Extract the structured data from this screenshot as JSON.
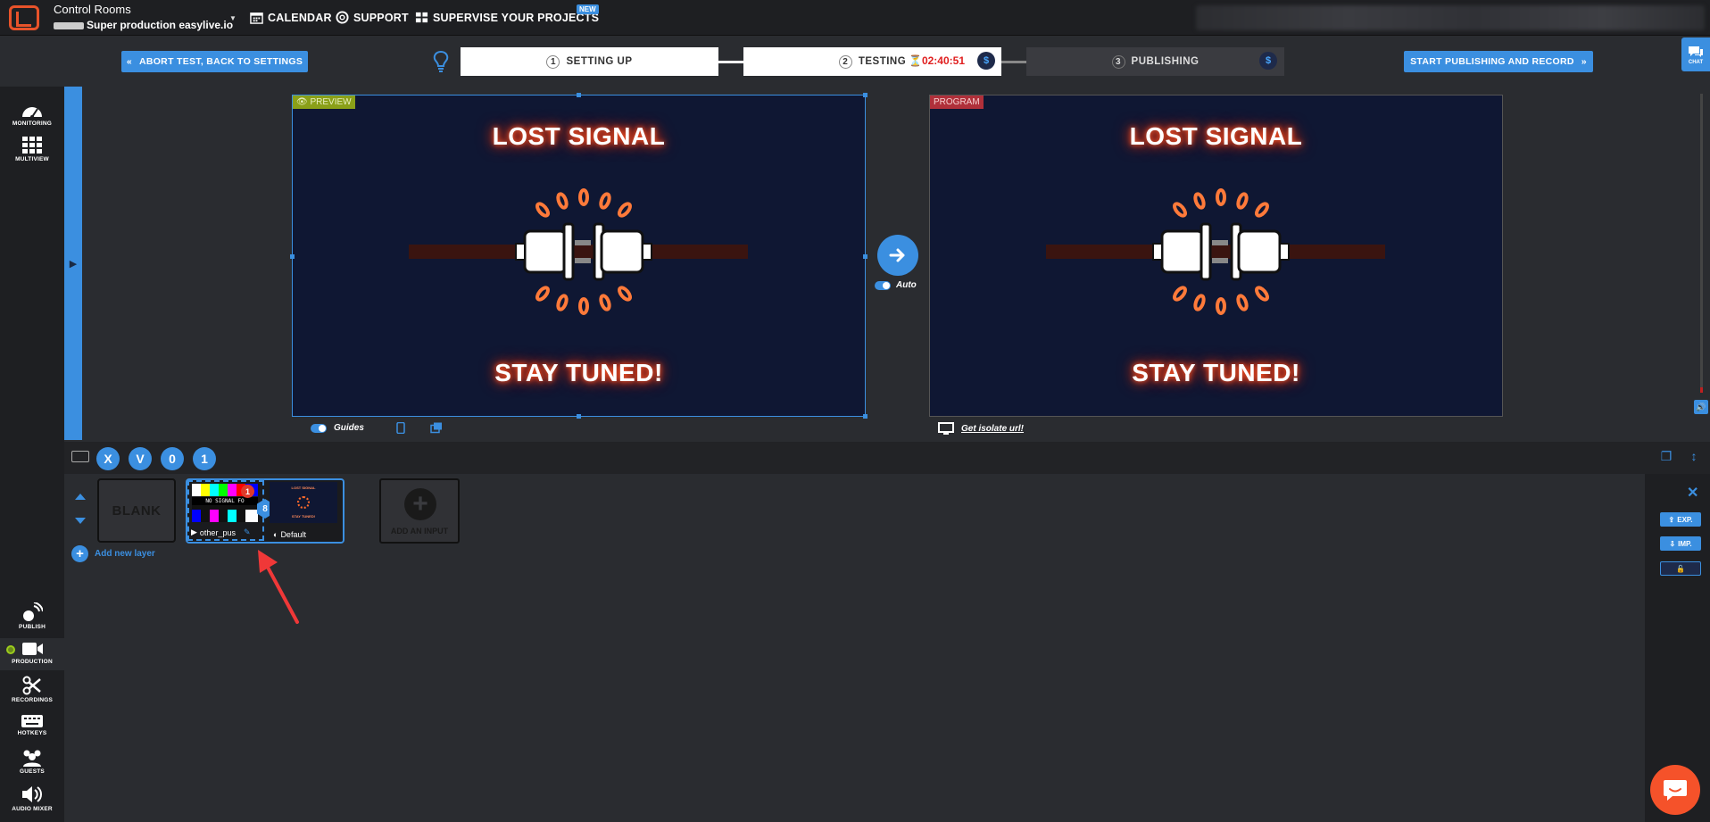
{
  "topbar": {
    "brand_title": "Control Rooms",
    "brand_sub": "Super production easylive.io",
    "nav": {
      "calendar": "CALENDAR",
      "support": "SUPPORT",
      "supervise": "SUPERVISE YOUR PROJECTS",
      "new_badge": "NEW"
    }
  },
  "steps": {
    "abort_label": "ABORT TEST, BACK TO SETTINGS",
    "step1_num": "1",
    "step1_label": "SETTING UP",
    "step2_num": "2",
    "step2_label": "TESTING",
    "timer": "02:40:51",
    "step3_num": "3",
    "step3_label": "PUBLISHING",
    "dollar": "$",
    "start_label": "START PUBLISHING AND RECORD",
    "chat_label": "CHAT"
  },
  "sidebar": {
    "monitoring": "MONITORING",
    "multiview": "MULTIVIEW",
    "publish": "PUBLISH",
    "production": "PRODUCTION",
    "recordings": "RECORDINGS",
    "hotkeys": "HOTKEYS",
    "guests": "GUESTS",
    "audio_mixer": "AUDIO MIXER"
  },
  "preview": {
    "tag": "PREVIEW",
    "headline": "LOST SIGNAL",
    "footer": "STAY TUNED!"
  },
  "program": {
    "tag": "PROGRAM",
    "headline": "LOST SIGNAL",
    "footer": "STAY TUNED!"
  },
  "controls": {
    "auto_label": "Auto",
    "guides_label": "Guides",
    "isolate_label": "Get isolate url!"
  },
  "layer_bar": {
    "buttons": [
      "X",
      "V",
      "0",
      "1"
    ]
  },
  "layers": {
    "blank_label": "BLANK",
    "input_name": "other_pus",
    "input_badge": "1",
    "no_signal": "NO SIGNAL FO",
    "link_mark": "8",
    "default_label": "Default",
    "mini_headline": "LOST SIGNAL",
    "mini_footer": "STAY TUNED!",
    "add_input_label": "ADD AN INPUT",
    "add_layer_label": "Add new layer"
  },
  "right_panel": {
    "export_label": "EXP.",
    "import_label": "IMP."
  },
  "colors": {
    "accent": "#3b8fe0",
    "brand_orange": "#e8532a",
    "preview_tag": "#8aa018",
    "program_tag": "#b0303a",
    "timer_red": "#e02020"
  }
}
